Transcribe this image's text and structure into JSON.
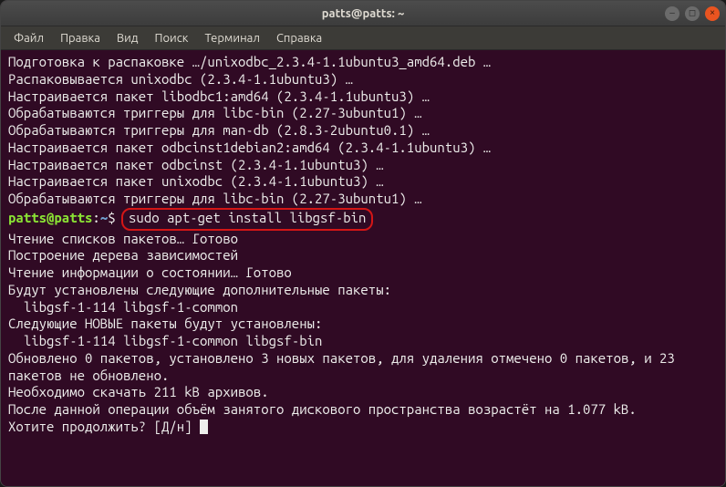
{
  "titlebar": {
    "title": "patts@patts: ~"
  },
  "menu": {
    "file": "Файл",
    "edit": "Правка",
    "view": "Вид",
    "search": "Поиск",
    "terminal": "Терминал",
    "help": "Справка"
  },
  "prompt": {
    "userhost": "patts@patts",
    "colon": ":",
    "path": "~",
    "dollar": "$"
  },
  "command": "sudo apt-get install libgsf-bin",
  "output": {
    "l1": "Подготовка к распаковке …/unixodbc_2.3.4-1.1ubuntu3_amd64.deb …",
    "l2": "Распаковывается unixodbc (2.3.4-1.1ubuntu3) …",
    "l3": "Настраивается пакет libodbc1:amd64 (2.3.4-1.1ubuntu3) …",
    "l4": "Обрабатываются триггеры для libc-bin (2.27-3ubuntu1) …",
    "l5": "Обрабатываются триггеры для man-db (2.8.3-2ubuntu0.1) …",
    "l6": "Настраивается пакет odbcinst1debian2:amd64 (2.3.4-1.1ubuntu3) …",
    "l7": "Настраивается пакет odbcinst (2.3.4-1.1ubuntu3) …",
    "l8": "Настраивается пакет unixodbc (2.3.4-1.1ubuntu3) …",
    "l9": "Обрабатываются триггеры для libc-bin (2.27-3ubuntu1) …",
    "l10": "Чтение списков пакетов… Готово",
    "l11": "Построение дерева зависимостей       ",
    "l12": "Чтение информации о состоянии… Готово",
    "l13": "Будут установлены следующие дополнительные пакеты:",
    "l14": "  libgsf-1-114 libgsf-1-common",
    "l15": "Следующие НОВЫЕ пакеты будут установлены:",
    "l16": "  libgsf-1-114 libgsf-1-common libgsf-bin",
    "l17": "Обновлено 0 пакетов, установлено 3 новых пакетов, для удаления отмечено 0 пакетов, и 23 пакетов не обновлено.",
    "l18": "Необходимо скачать 211 kB архивов.",
    "l19": "После данной операции объём занятого дискового пространства возрастёт на 1.077 kB.",
    "l20": "Хотите продолжить? [Д/н] "
  }
}
